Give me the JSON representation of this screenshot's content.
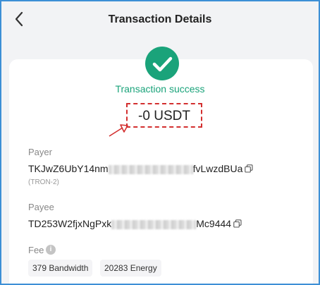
{
  "header": {
    "title": "Transaction Details"
  },
  "status": {
    "text": "Transaction success",
    "color": "#1aa37a"
  },
  "amount": {
    "text": "-0 USDT"
  },
  "payer": {
    "label": "Payer",
    "address_start": "TKJwZ6UbY14nm",
    "address_end": "fvLwzdBUa",
    "network": "(TRON-2)"
  },
  "payee": {
    "label": "Payee",
    "address_start": "TD253W2fjxNgPxk",
    "address_end": "Mc9444"
  },
  "fee": {
    "label": "Fee",
    "info_glyph": "i",
    "bandwidth": "379 Bandwidth",
    "energy": "20283 Energy"
  },
  "icons": {
    "back": "chevron-left-icon",
    "success": "check-circle-icon",
    "copy": "copy-icon",
    "info": "info-icon"
  },
  "colors": {
    "annotation": "#d32f2f",
    "frame": "#3d8fd6"
  }
}
